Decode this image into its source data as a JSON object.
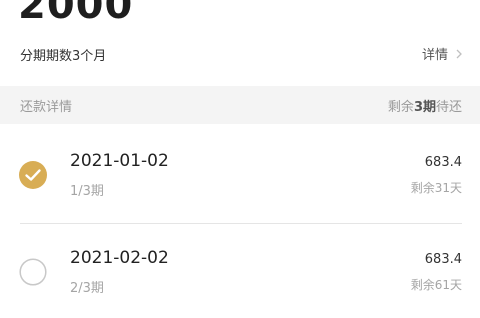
{
  "loan": {
    "amount": "2000",
    "term_label": "分期期数3个月",
    "detail_link": "详情"
  },
  "repayment": {
    "header_title": "还款详情",
    "remaining_prefix": "剩余",
    "remaining_periods": "3期",
    "remaining_suffix": "待还",
    "items": [
      {
        "date": "2021-01-02",
        "period": "1/3期",
        "amount": "683.4",
        "remaining_days": "剩余31天",
        "checked": true,
        "check_color": "#d8ad55"
      },
      {
        "date": "2021-02-02",
        "period": "2/3期",
        "amount": "683.4",
        "remaining_days": "剩余61天",
        "checked": false,
        "check_color": "#c8c8c8"
      }
    ]
  }
}
